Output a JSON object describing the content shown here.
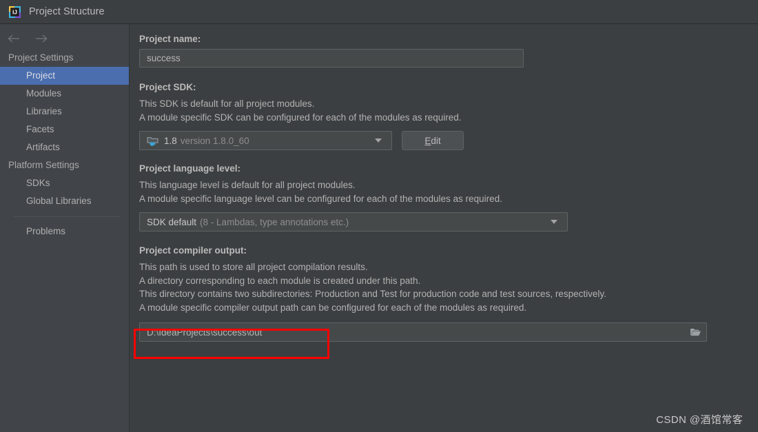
{
  "window": {
    "title": "Project Structure",
    "logo_icon": "intellij-idea-logo"
  },
  "nav": {
    "back_icon": "arrow-left-icon",
    "forward_icon": "arrow-right-icon"
  },
  "sidebar": {
    "groups": [
      {
        "label": "Project Settings",
        "items": [
          {
            "label": "Project",
            "selected": true
          },
          {
            "label": "Modules",
            "selected": false
          },
          {
            "label": "Libraries",
            "selected": false
          },
          {
            "label": "Facets",
            "selected": false
          },
          {
            "label": "Artifacts",
            "selected": false
          }
        ]
      },
      {
        "label": "Platform Settings",
        "items": [
          {
            "label": "SDKs",
            "selected": false
          },
          {
            "label": "Global Libraries",
            "selected": false
          }
        ]
      }
    ],
    "problems_label": "Problems"
  },
  "main": {
    "project_name": {
      "label": "Project name:",
      "value": "success"
    },
    "project_sdk": {
      "label": "Project SDK:",
      "descriptions": [
        "This SDK is default for all project modules.",
        "A module specific SDK can be configured for each of the modules as required."
      ],
      "selected_name": "1.8",
      "selected_version": "version 1.8.0_60",
      "sdk_icon": "java-sdk-icon",
      "dropdown_icon": "chevron-down-icon",
      "edit_button": {
        "mnemonic": "E",
        "rest": "dit"
      }
    },
    "language_level": {
      "label": "Project language level:",
      "descriptions": [
        "This language level is default for all project modules.",
        "A module specific language level can be configured for each of the modules as required."
      ],
      "selected_name": "SDK default",
      "selected_detail": "(8 - Lambdas, type annotations etc.)",
      "dropdown_icon": "chevron-down-icon"
    },
    "compiler_output": {
      "label": "Project compiler output:",
      "descriptions": [
        "This path is used to store all project compilation results.",
        "A directory corresponding to each module is created under this path.",
        "This directory contains two subdirectories: Production and Test for production code and test sources, respectively.",
        "A module specific compiler output path can be configured for each of the modules as required."
      ],
      "value": "D:\\IdeaProjects\\success\\out",
      "browse_icon": "folder-open-icon"
    }
  },
  "annotation": {
    "color": "#fe0000"
  },
  "watermark": {
    "text": "CSDN @酒馆常客"
  }
}
